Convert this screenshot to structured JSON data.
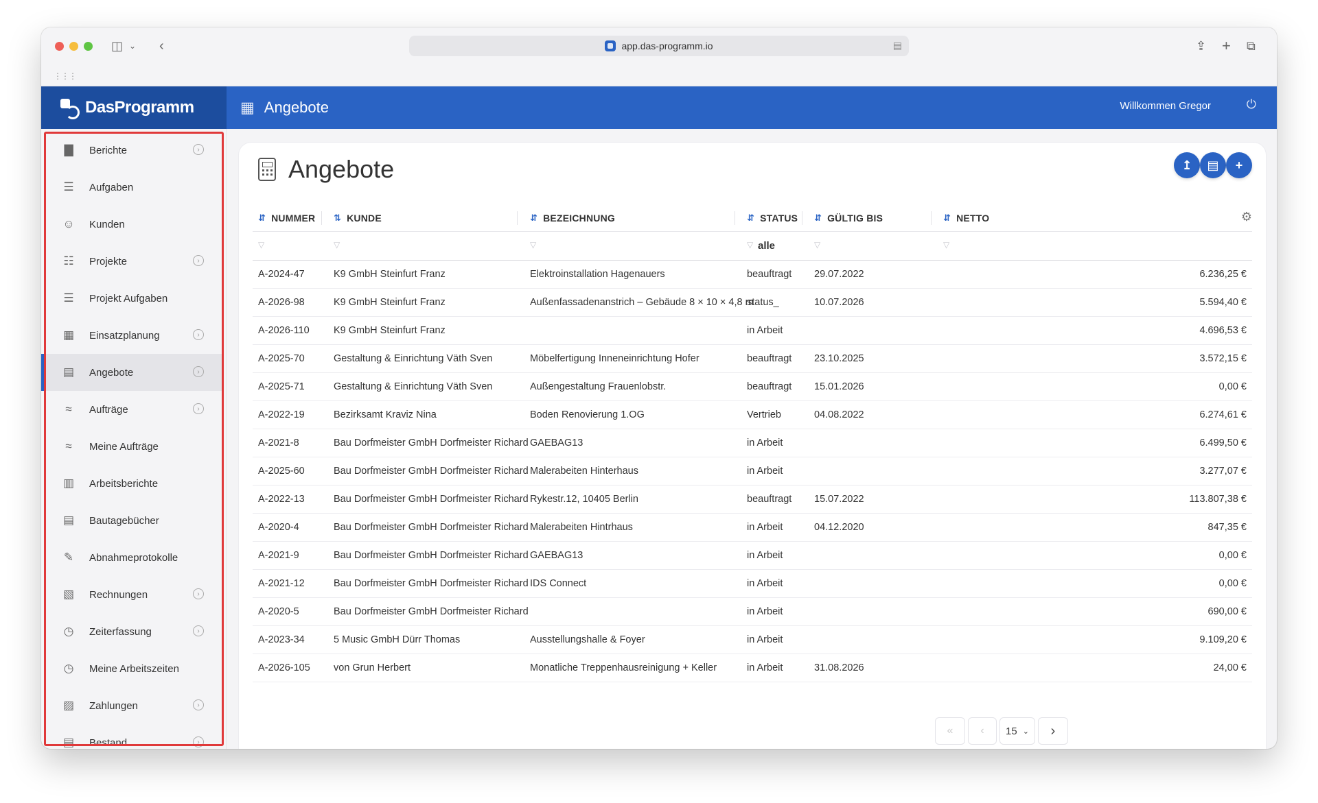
{
  "browser": {
    "url": "app.das-programm.io"
  },
  "app": {
    "logo_text": "DasProgramm",
    "header_title": "Angebote",
    "welcome": "Willkommen Gregor"
  },
  "sidebar": {
    "items": [
      {
        "label": "Berichte",
        "icon": "chart-icon",
        "has_arrow": true
      },
      {
        "label": "Aufgaben",
        "icon": "checklist-icon",
        "has_arrow": false
      },
      {
        "label": "Kunden",
        "icon": "contact-icon",
        "has_arrow": false
      },
      {
        "label": "Projekte",
        "icon": "project-icon",
        "has_arrow": true
      },
      {
        "label": "Projekt Aufgaben",
        "icon": "checklist-icon",
        "has_arrow": false
      },
      {
        "label": "Einsatzplanung",
        "icon": "calendar-icon",
        "has_arrow": true
      },
      {
        "label": "Angebote",
        "icon": "calculator-icon",
        "has_arrow": true,
        "active": true
      },
      {
        "label": "Aufträge",
        "icon": "handshake-icon",
        "has_arrow": true
      },
      {
        "label": "Meine Aufträge",
        "icon": "handshake-icon",
        "has_arrow": false
      },
      {
        "label": "Arbeitsberichte",
        "icon": "report-icon",
        "has_arrow": false
      },
      {
        "label": "Bautagebücher",
        "icon": "book-icon",
        "has_arrow": false
      },
      {
        "label": "Abnahmeprotokolle",
        "icon": "signature-icon",
        "has_arrow": false
      },
      {
        "label": "Rechnungen",
        "icon": "invoice-icon",
        "has_arrow": true
      },
      {
        "label": "Zeiterfassung",
        "icon": "clock-icon",
        "has_arrow": true
      },
      {
        "label": "Meine Arbeitszeiten",
        "icon": "clock-icon",
        "has_arrow": false
      },
      {
        "label": "Zahlungen",
        "icon": "cash-register-icon",
        "has_arrow": true
      },
      {
        "label": "Bestand",
        "icon": "warehouse-icon",
        "has_arrow": true
      }
    ]
  },
  "main": {
    "title": "Angebote",
    "columns": {
      "nummer": "NUMMER",
      "kunde": "KUNDE",
      "bezeichnung": "BEZEICHNUNG",
      "status": "STATUS",
      "gueltig_bis": "GÜLTIG BIS",
      "netto": "NETTO"
    },
    "filter_status": "alle",
    "rows": [
      {
        "nummer": "A-2024-47",
        "kunde": "K9 GmbH Steinfurt Franz",
        "bezeichnung": "Elektroinstallation Hagenauers",
        "status": "beauftragt",
        "gueltig_bis": "29.07.2022",
        "netto": "6.236,25 €"
      },
      {
        "nummer": "A-2026-98",
        "kunde": "K9 GmbH Steinfurt Franz",
        "bezeichnung": "Außenfassadenanstrich – Gebäude 8 × 10 × 4,8 m",
        "status": "status_",
        "gueltig_bis": "10.07.2026",
        "netto": "5.594,40 €"
      },
      {
        "nummer": "A-2026-110",
        "kunde": "K9 GmbH Steinfurt Franz",
        "bezeichnung": "",
        "status": "in Arbeit",
        "gueltig_bis": "",
        "netto": "4.696,53 €"
      },
      {
        "nummer": "A-2025-70",
        "kunde": "Gestaltung & Einrichtung Väth Sven",
        "bezeichnung": "Möbelfertigung Inneneinrichtung Hofer",
        "status": "beauftragt",
        "gueltig_bis": "23.10.2025",
        "netto": "3.572,15 €"
      },
      {
        "nummer": "A-2025-71",
        "kunde": "Gestaltung & Einrichtung Väth Sven",
        "bezeichnung": "Außengestaltung Frauenlobstr.",
        "status": "beauftragt",
        "gueltig_bis": "15.01.2026",
        "netto": "0,00 €"
      },
      {
        "nummer": "A-2022-19",
        "kunde": "Bezirksamt Kraviz Nina",
        "bezeichnung": "Boden Renovierung 1.OG",
        "status": "Vertrieb",
        "gueltig_bis": "04.08.2022",
        "netto": "6.274,61 €"
      },
      {
        "nummer": "A-2021-8",
        "kunde": "Bau Dorfmeister GmbH Dorfmeister Richard",
        "bezeichnung": "GAEBAG13",
        "status": "in Arbeit",
        "gueltig_bis": "",
        "netto": "6.499,50 €"
      },
      {
        "nummer": "A-2025-60",
        "kunde": "Bau Dorfmeister GmbH Dorfmeister Richard",
        "bezeichnung": "Malerabeiten Hinterhaus",
        "status": "in Arbeit",
        "gueltig_bis": "",
        "netto": "3.277,07 €"
      },
      {
        "nummer": "A-2022-13",
        "kunde": "Bau Dorfmeister GmbH Dorfmeister Richard",
        "bezeichnung": "Rykestr.12, 10405 Berlin",
        "status": "beauftragt",
        "gueltig_bis": "15.07.2022",
        "netto": "113.807,38 €"
      },
      {
        "nummer": "A-2020-4",
        "kunde": "Bau Dorfmeister GmbH Dorfmeister Richard",
        "bezeichnung": "Malerabeiten Hintrhaus",
        "status": "in Arbeit",
        "gueltig_bis": "04.12.2020",
        "netto": "847,35 €"
      },
      {
        "nummer": "A-2021-9",
        "kunde": "Bau Dorfmeister GmbH Dorfmeister Richard",
        "bezeichnung": "GAEBAG13",
        "status": "in Arbeit",
        "gueltig_bis": "",
        "netto": "0,00 €"
      },
      {
        "nummer": "A-2021-12",
        "kunde": "Bau Dorfmeister GmbH Dorfmeister Richard",
        "bezeichnung": "IDS Connect",
        "status": "in Arbeit",
        "gueltig_bis": "",
        "netto": "0,00 €"
      },
      {
        "nummer": "A-2020-5",
        "kunde": "Bau Dorfmeister GmbH Dorfmeister Richard",
        "bezeichnung": "",
        "status": "in Arbeit",
        "gueltig_bis": "",
        "netto": "690,00 €"
      },
      {
        "nummer": "A-2023-34",
        "kunde": "5 Music GmbH Dürr Thomas",
        "bezeichnung": "Ausstellungshalle & Foyer",
        "status": "in Arbeit",
        "gueltig_bis": "",
        "netto": "9.109,20 €"
      },
      {
        "nummer": "A-2026-105",
        "kunde": "von Grun Herbert",
        "bezeichnung": "Monatliche Treppenhausreinigung + Keller",
        "status": "in Arbeit",
        "gueltig_bis": "31.08.2026",
        "netto": "24,00 €"
      }
    ],
    "page_size": "15"
  },
  "colors": {
    "primary": "#2a63c4",
    "logo_bg": "#1c4d9e",
    "highlight": "#e0393a"
  }
}
